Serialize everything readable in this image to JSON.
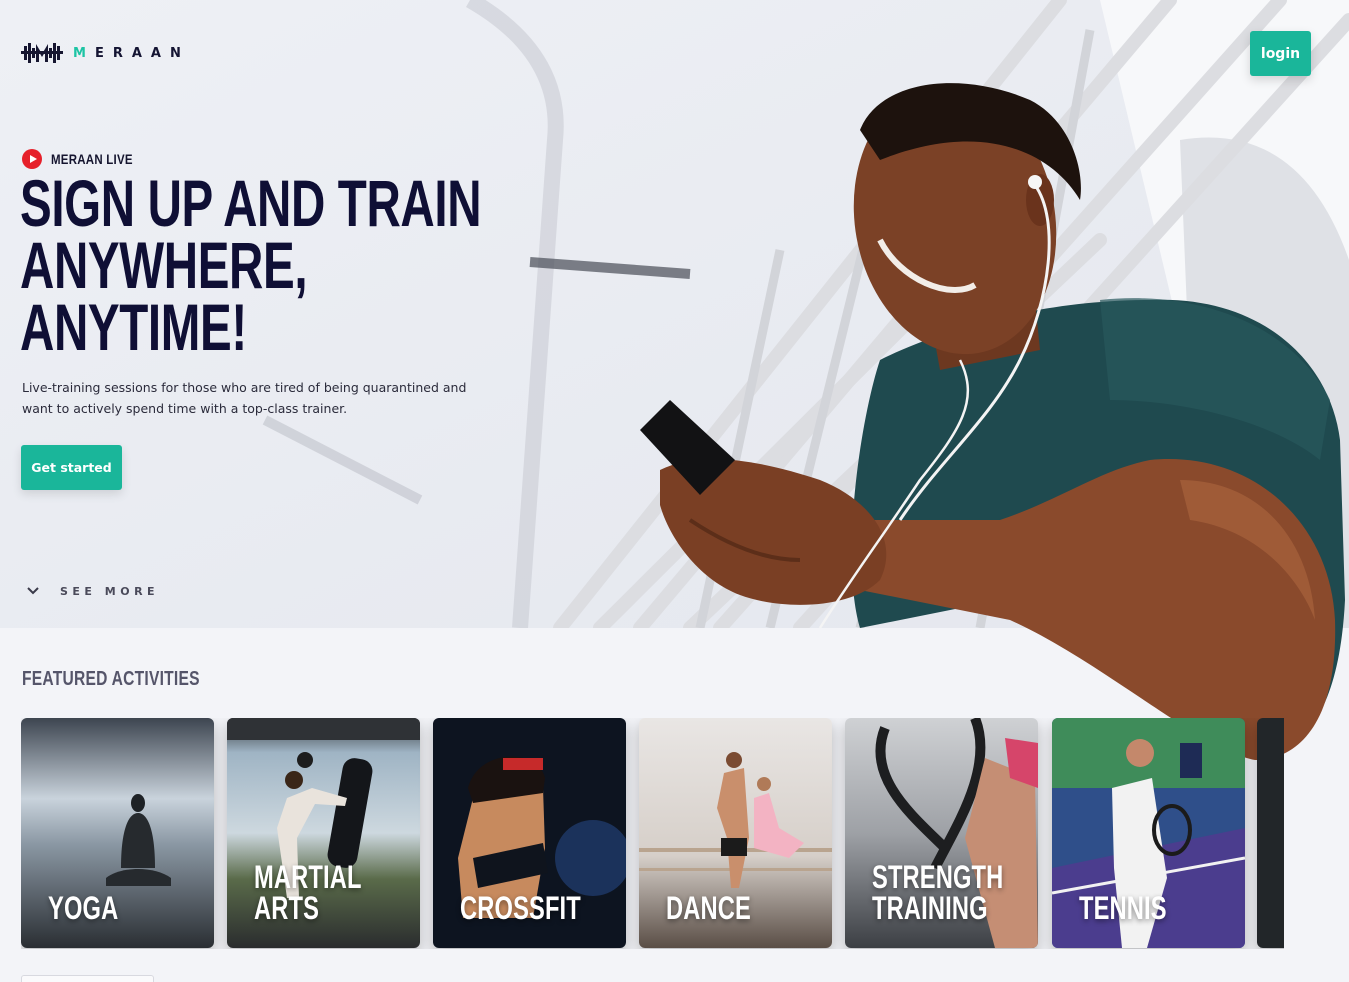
{
  "brand": {
    "logo_prefix": "M",
    "logo_rest": "ERAAN",
    "accent_color": "#1ab69a",
    "live_color": "#e6202a"
  },
  "header": {
    "login_label": "login"
  },
  "hero": {
    "live_tag": "MERAAN LIVE",
    "headline_lines": [
      "SIGN UP AND TRAIN",
      "ANYWHERE,",
      "ANYTIME!"
    ],
    "subtitle": "Live-training sessions for those who are tired of being quarantined and want to actively spend time with a top-class trainer.",
    "cta_label": "Get started",
    "see_more_label": "SEE MORE"
  },
  "featured": {
    "title": "FEATURED ACTIVITIES",
    "activities": [
      {
        "label": "YOGA"
      },
      {
        "label": "MARTIAL ARTS"
      },
      {
        "label": "CROSSFIT"
      },
      {
        "label": "DANCE"
      },
      {
        "label": "STRENGTH\nTRAINING"
      },
      {
        "label": "TENNIS"
      }
    ]
  }
}
